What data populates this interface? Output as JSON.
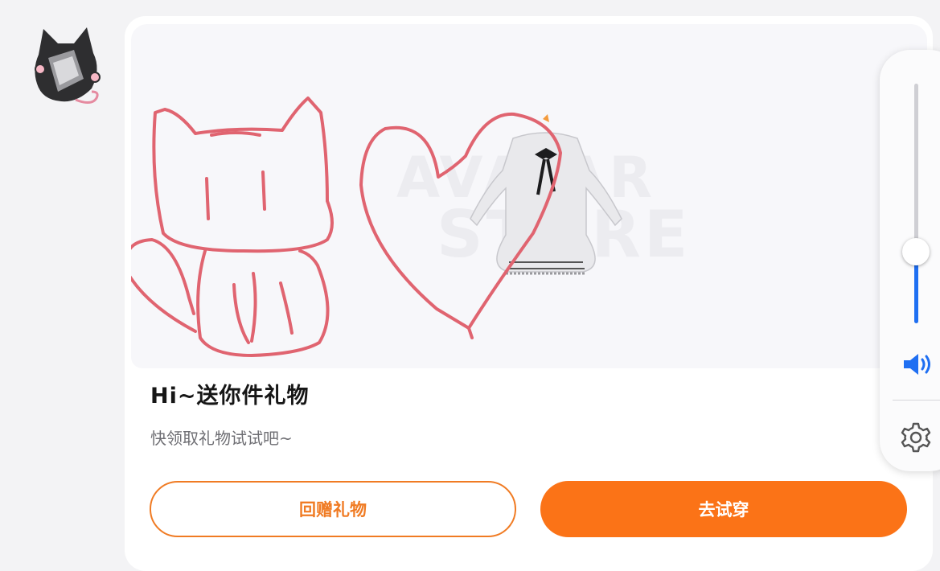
{
  "card": {
    "title": "Hi~送你件礼物",
    "subtitle": "快领取礼物试试吧~",
    "banner": {
      "watermark_line1": "AVATAR",
      "watermark_line2": "STORE",
      "item": "dress-image"
    }
  },
  "buttons": {
    "return_gift": "回赠礼物",
    "try_on": "去试穿"
  },
  "volume": {
    "level": 0.3,
    "icons": [
      "speaker-icon",
      "gear-icon"
    ]
  },
  "colors": {
    "accent": "#fb7317",
    "outline": "#f07b23",
    "doodle": "#e06470",
    "volume_fill": "#1f6ff2"
  }
}
